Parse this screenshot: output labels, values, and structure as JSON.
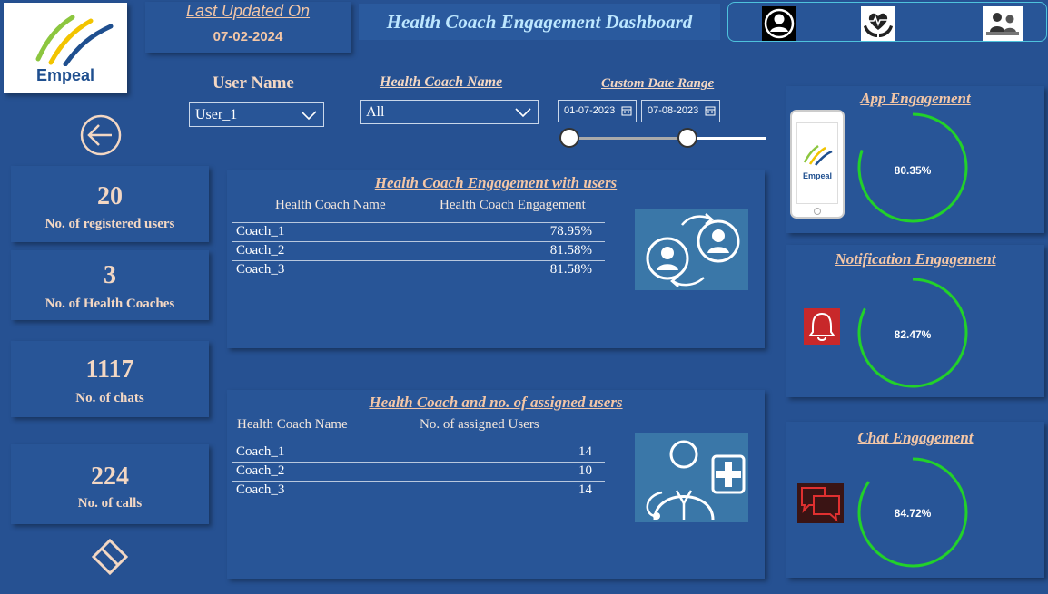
{
  "header": {
    "logo_text": "Empeal",
    "last_updated_label": "Last Updated On",
    "last_updated_date": "07-02-2024",
    "title": "Health Coach Engagement Dashboard"
  },
  "filters": {
    "user_name_label": "User Name",
    "user_name_value": "User_1",
    "coach_name_label": "Health Coach Name",
    "coach_name_value": "All",
    "date_range_label": "Custom Date Range",
    "date_start": "01-07-2023",
    "date_end": "07-08-2023"
  },
  "kpis": [
    {
      "value": "20",
      "label": "No. of registered users"
    },
    {
      "value": "3",
      "label": "No. of Health Coaches"
    },
    {
      "value": "1117",
      "label": "No. of chats"
    },
    {
      "value": "224",
      "label": "No. of calls"
    }
  ],
  "engagement_table": {
    "title": "Health Coach Engagement with users",
    "col1": "Health Coach Name",
    "col2": "Health Coach Engagement",
    "rows": [
      {
        "name": "Coach_1",
        "value": "78.95%"
      },
      {
        "name": "Coach_2",
        "value": "81.58%"
      },
      {
        "name": "Coach_3",
        "value": "81.58%"
      }
    ]
  },
  "assigned_table": {
    "title": "Health Coach and no. of assigned users",
    "col1": "Health Coach Name",
    "col2": "No. of assigned Users",
    "rows": [
      {
        "name": "Coach_1",
        "value": "14"
      },
      {
        "name": "Coach_2",
        "value": "10"
      },
      {
        "name": "Coach_3",
        "value": "14"
      }
    ]
  },
  "gauges": [
    {
      "title": "App Engagement",
      "value_text": "80.35%",
      "value": 80.35,
      "phone_logo_text": "Empeal"
    },
    {
      "title": "Notification Engagement",
      "value_text": "82.47%",
      "value": 82.47
    },
    {
      "title": "Chat Engagement",
      "value_text": "84.72%",
      "value": 84.72
    }
  ],
  "colors": {
    "background": "#265192",
    "gauge_arc": "#22d12a",
    "title_text": "#bde7ff",
    "accent_text": "#f3c6a6"
  }
}
